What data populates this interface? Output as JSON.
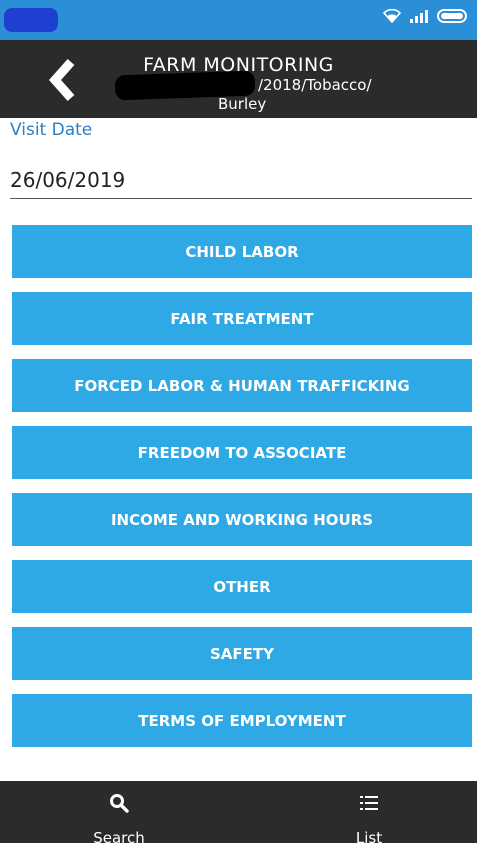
{
  "status_bar": {
    "icons": [
      "wifi-icon",
      "signal-icon",
      "battery-icon"
    ],
    "color": "#2a8fd6"
  },
  "header": {
    "title": "FARM MONITORING",
    "subtitle_line1": "/2018/Tobacco/",
    "subtitle_line2": "Burley",
    "back_icon": "chevron-left-icon",
    "background": "#2b2b2b"
  },
  "visit": {
    "label": "Visit Date",
    "date": "26/06/2019"
  },
  "buttons": [
    "CHILD LABOR",
    "FAIR TREATMENT",
    "FORCED LABOR & HUMAN TRAFFICKING",
    "FREEDOM TO ASSOCIATE",
    "INCOME AND WORKING HOURS",
    "OTHER",
    "SAFETY",
    "TERMS OF EMPLOYMENT"
  ],
  "bottom_nav": {
    "search_label": "Search",
    "list_label": "List",
    "search_icon": "search-icon",
    "list_icon": "list-icon"
  },
  "colors": {
    "accent": "#2fa9e5",
    "label_blue": "#2a7fc5"
  }
}
